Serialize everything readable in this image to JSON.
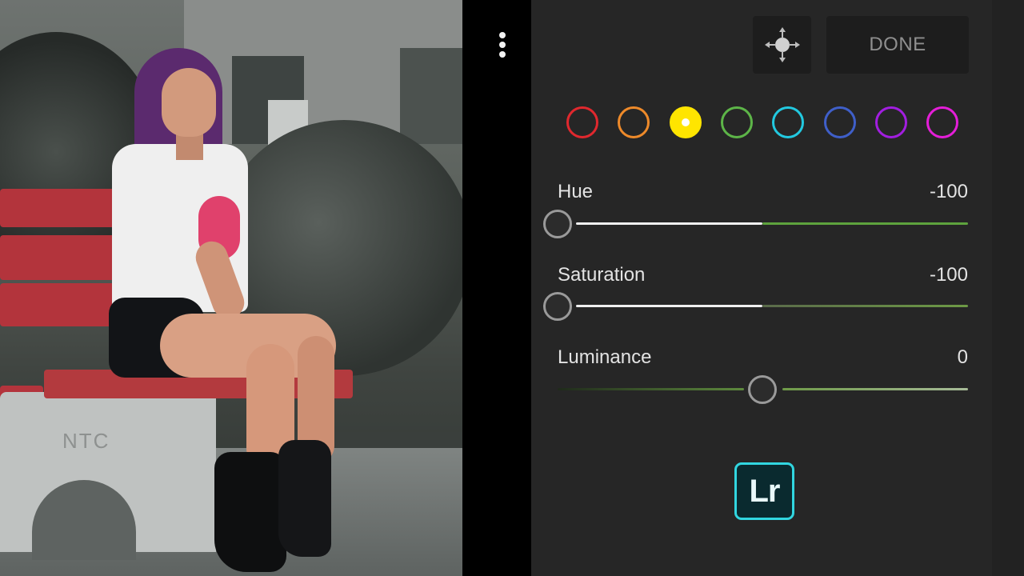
{
  "toolbar": {
    "done_label": "DONE",
    "target_icon": "target-adjust-icon",
    "more_icon": "more-vertical-icon"
  },
  "color_swatches": [
    {
      "name": "red",
      "color": "#e0282e",
      "selected": false
    },
    {
      "name": "orange",
      "color": "#ee8a2a",
      "selected": false
    },
    {
      "name": "yellow",
      "color": "#ffe500",
      "selected": true
    },
    {
      "name": "green",
      "color": "#5db548",
      "selected": false
    },
    {
      "name": "aqua",
      "color": "#22c9e0",
      "selected": false
    },
    {
      "name": "blue",
      "color": "#3f5fc9",
      "selected": false
    },
    {
      "name": "purple",
      "color": "#a21ee0",
      "selected": false
    },
    {
      "name": "magenta",
      "color": "#e41ed8",
      "selected": false
    }
  ],
  "sliders": {
    "hue": {
      "label": "Hue",
      "value": "-100"
    },
    "saturation": {
      "label": "Saturation",
      "value": "-100"
    },
    "luminance": {
      "label": "Luminance",
      "value": "0"
    }
  },
  "photo": {
    "bench_text": "NTC"
  },
  "logo": {
    "text": "Lr",
    "accent": "#31d6e0"
  }
}
